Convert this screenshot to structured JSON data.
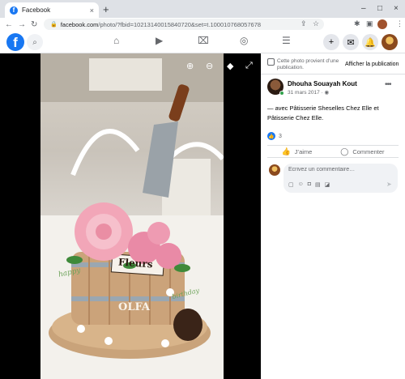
{
  "browser": {
    "tab_title": "Facebook",
    "tab_close": "×",
    "new_tab": "+",
    "url_host": "facebook.com",
    "url_path": "/photo/?fbid=10213140015840720&set=t.100010768057678",
    "icons": [
      "back-arrow",
      "forward-arrow",
      "reload",
      "lock",
      "share",
      "star",
      "extensions",
      "sidepanel",
      "profile",
      "menu"
    ],
    "window_controls": [
      "–",
      "□",
      "×"
    ]
  },
  "facebook": {
    "logo": "f",
    "nav_icons": [
      "home",
      "video",
      "marketplace",
      "groups",
      "menu"
    ],
    "right_icons": [
      "plus",
      "messenger",
      "bell",
      "profile"
    ]
  },
  "viewer": {
    "photo_subject": "Decorated cake with pink flowers and a knife",
    "cake_plaque_text": "Fleurs",
    "cake_name_text": "OLFA",
    "cake_side_text_left": "happy",
    "cake_side_text_right": "birthday",
    "toolbar_icons": [
      "zoom-in",
      "zoom-out",
      "tag",
      "fullscreen"
    ]
  },
  "panel": {
    "notice_text": "Cette photo provient d’une publication.",
    "notice_link": "Afficher la publication",
    "author_name": "Dhouha Souayah Kout",
    "post_date": "31 mars 2017 · ",
    "more_label": "•••",
    "caption_prefix": "— avec ",
    "caption_tag1": "Pâtisserie Sheselles Chez Elle",
    "caption_joiner": " et ",
    "caption_tag2": "Pâtisserie Chez Elle",
    "caption_suffix": ".",
    "reaction_count": "3",
    "like_label": "J’aime",
    "comment_label": "Commenter",
    "comment_placeholder": "Écrivez un commentaire…"
  },
  "colors": {
    "facebook_blue": "#1877f2",
    "online_green": "#31a24c",
    "viewer_bg": "#000000"
  }
}
